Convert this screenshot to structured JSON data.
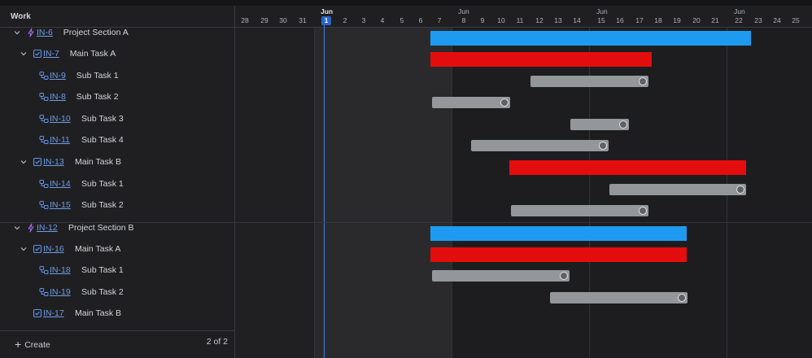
{
  "header": {
    "work_label": "Work"
  },
  "timeline": {
    "days": [
      "28",
      "29",
      "30",
      "31",
      "1",
      "2",
      "3",
      "4",
      "5",
      "6",
      "7",
      "8",
      "9",
      "10",
      "11",
      "12",
      "13",
      "14",
      "15",
      "16",
      "17",
      "18",
      "19",
      "20",
      "21",
      "22",
      "23",
      "24",
      "25"
    ],
    "month_labels": [
      "Jun",
      "Jun",
      "Jun",
      "Jun"
    ],
    "today": "1"
  },
  "rows": [
    {
      "key": "IN-6",
      "title": "Project Section A",
      "type": "epic",
      "expandable": true,
      "level": 0
    },
    {
      "key": "IN-7",
      "title": "Main Task A",
      "type": "task",
      "expandable": true,
      "level": 1
    },
    {
      "key": "IN-9",
      "title": "Sub Task 1",
      "type": "subtask",
      "level": 2
    },
    {
      "key": "IN-8",
      "title": "Sub Task 2",
      "type": "subtask",
      "level": 2
    },
    {
      "key": "IN-10",
      "title": "Sub Task 3",
      "type": "subtask",
      "level": 2
    },
    {
      "key": "IN-11",
      "title": "Sub Task 4",
      "type": "subtask",
      "level": 2
    },
    {
      "key": "IN-13",
      "title": "Main Task B",
      "type": "task",
      "expandable": true,
      "level": 1
    },
    {
      "key": "IN-14",
      "title": "Sub Task 1",
      "type": "subtask",
      "level": 2
    },
    {
      "key": "IN-15",
      "title": "Sub Task 2",
      "type": "subtask",
      "level": 2
    },
    {
      "key": "IN-12",
      "title": "Project Section B",
      "type": "epic",
      "expandable": true,
      "level": 0
    },
    {
      "key": "IN-16",
      "title": "Main Task A",
      "type": "task",
      "expandable": true,
      "level": 1
    },
    {
      "key": "IN-18",
      "title": "Sub Task 1",
      "type": "subtask",
      "level": 2
    },
    {
      "key": "IN-19",
      "title": "Sub Task 2",
      "type": "subtask",
      "level": 2
    },
    {
      "key": "IN-17",
      "title": "Main Task B",
      "type": "task",
      "expandable": false,
      "level": 1
    }
  ],
  "footer": {
    "create_label": "Create",
    "pager": "2 of 2"
  },
  "colors": {
    "epic_bar": "#1e9bf0",
    "task_bar": "#e40d0d",
    "subtask_bar": "#93969b",
    "today_line": "#3f7ee8",
    "link": "#6d9ce8",
    "epic_icon": "#a56ef2"
  }
}
